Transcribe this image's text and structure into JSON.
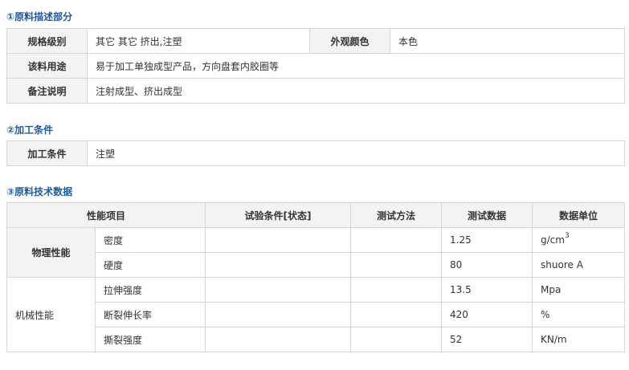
{
  "section1": {
    "title": "①原料描述部分",
    "rows": [
      {
        "label": "规格级别",
        "value": "其它 其它 挤出,注塑",
        "label2": "外观颜色",
        "value2": "本色"
      },
      {
        "label": "该料用途",
        "value": "易于加工单独成型产品，方向盘套内胶圈等"
      },
      {
        "label": "备注说明",
        "value": "注射成型、挤出成型"
      }
    ]
  },
  "section2": {
    "title": "②加工条件",
    "rows": [
      {
        "label": "加工条件",
        "value": "注塑"
      }
    ]
  },
  "section3": {
    "title": "③原料技术数据",
    "headers": [
      "性能项目",
      "试验条件[状态]",
      "测试方法",
      "测试数据",
      "数据单位"
    ],
    "groups": [
      {
        "name": "物理性能",
        "rows": [
          {
            "item": "密度",
            "condition": "",
            "method": "",
            "value": "1.25",
            "unit": "g/cm",
            "unit_sup": "3"
          },
          {
            "item": "硬度",
            "condition": "",
            "method": "",
            "value": "80",
            "unit": "shuore A",
            "unit_sup": ""
          }
        ]
      },
      {
        "name": "机械性能",
        "rows": [
          {
            "item": "拉伸强度",
            "condition": "",
            "method": "",
            "value": "13.5",
            "unit": "Mpa",
            "unit_sup": ""
          },
          {
            "item": "断裂伸长率",
            "condition": "",
            "method": "",
            "value": "420",
            "unit": "%",
            "unit_sup": ""
          },
          {
            "item": "撕裂强度",
            "condition": "",
            "method": "",
            "value": "52",
            "unit": "KN/m",
            "unit_sup": ""
          }
        ]
      }
    ]
  }
}
